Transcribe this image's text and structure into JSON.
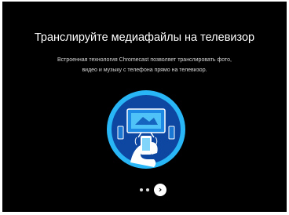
{
  "onboarding": {
    "title": "Транслируйте медиафайлы на телевизор",
    "description_line1": "Встроенная технология Chromecast позволяет транслировать фото,",
    "description_line2": "видео и музыку с телефона прямо на телевизор.",
    "illustration_icon": "phone-cast-to-tv-icon",
    "next_icon": "chevron-right-icon",
    "next_glyph": "›",
    "page_count": 3,
    "current_page": 3
  },
  "colors": {
    "background": "#000000",
    "illustration_ring": "#29b6f6",
    "illustration_inner": "#0d47a1",
    "text": "#ffffff"
  }
}
